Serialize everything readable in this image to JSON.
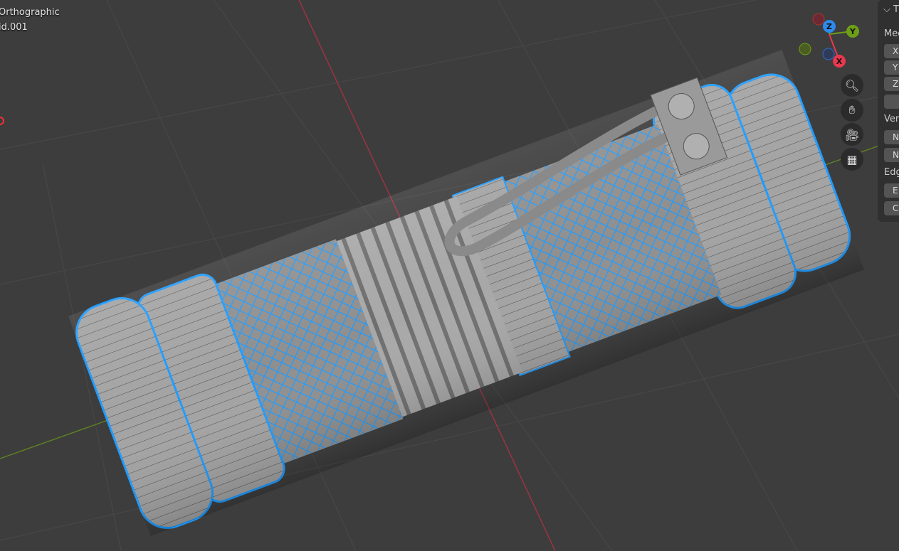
{
  "viewport": {
    "view_mode": "Orthographic",
    "object_name": "id.001"
  },
  "gizmo": {
    "x_label": "X",
    "y_label": "Y",
    "z_label": "Z",
    "colors": {
      "x": "#e8384f",
      "y": "#6c9f17",
      "z": "#2e8aed"
    }
  },
  "nav_buttons": [
    "zoom-icon",
    "pan-hand-icon",
    "camera-icon",
    "grid-ortho-icon"
  ],
  "n_panel": {
    "header": "T",
    "section1": "Med",
    "fields1": [
      "X",
      "Y",
      "Z",
      ""
    ],
    "section2": "Ver",
    "fields2": [
      "N",
      "N"
    ],
    "section3": "Edg",
    "fields3": [
      "E",
      "C"
    ]
  },
  "colors": {
    "background": "#3d3d3d",
    "selection": "#1e9bff",
    "mesh": "#9a9a9a"
  }
}
